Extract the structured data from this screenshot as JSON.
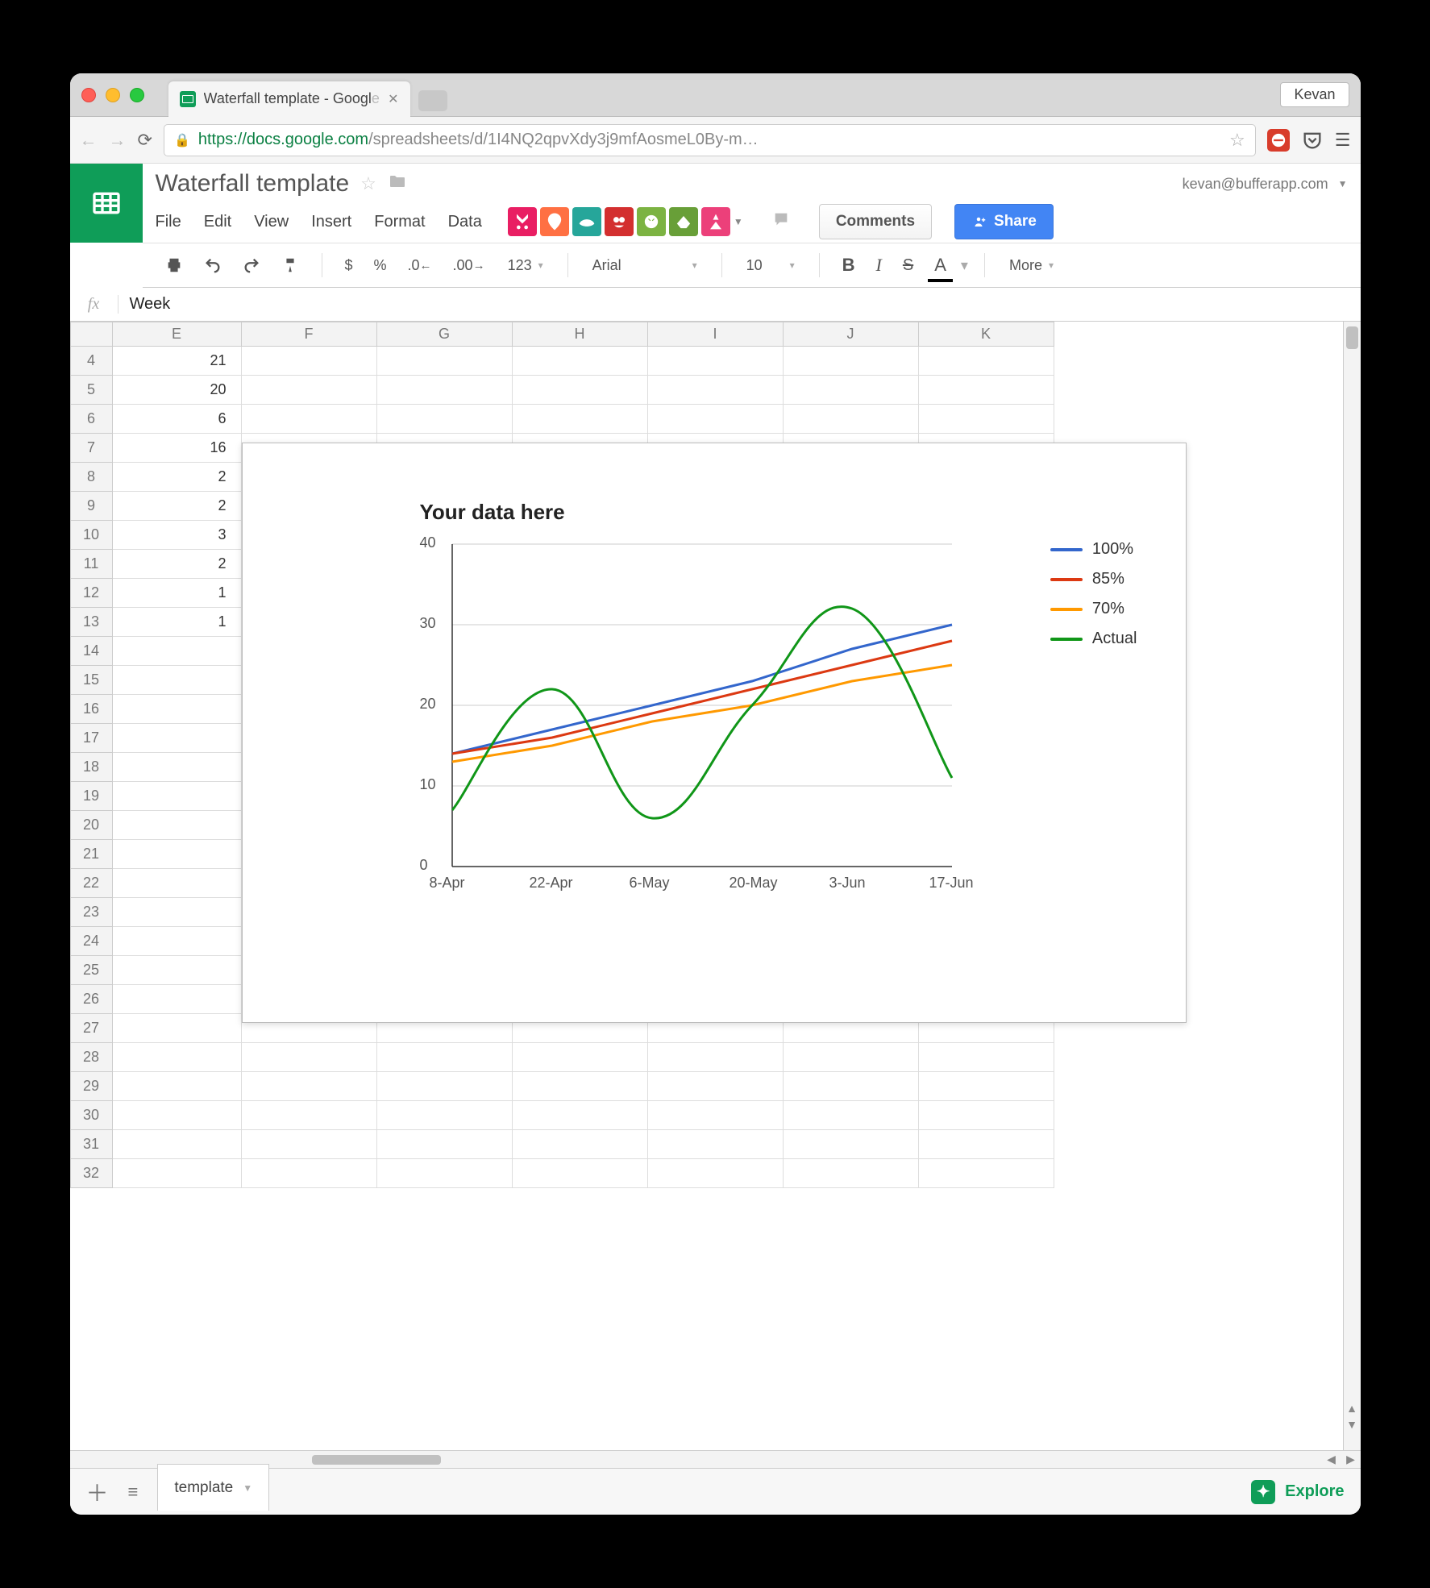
{
  "browser": {
    "profile_name": "Kevan",
    "tab_title": "Waterfall template - Googl",
    "tab_title_fade": "e",
    "url_host": "https://",
    "url_domain": "docs.google.com",
    "url_path": "/spreadsheets/d/1I4NQ2qpvXdy3j9mfAosmeL0By-m…"
  },
  "doc": {
    "title": "Waterfall template",
    "account": "kevan@bufferapp.com",
    "comments_btn": "Comments",
    "share_btn": "Share",
    "menu": {
      "file": "File",
      "edit": "Edit",
      "view": "View",
      "insert": "Insert",
      "format": "Format",
      "data": "Data"
    }
  },
  "toolbar": {
    "currency": "$",
    "percent": "%",
    "dec_dec": ".0",
    "inc_dec": ".00",
    "numfmt": "123",
    "font": "Arial",
    "size": "10",
    "more": "More"
  },
  "fx": {
    "value": "Week"
  },
  "columns": [
    "E",
    "F",
    "G",
    "H",
    "I",
    "J",
    "K"
  ],
  "rows": [
    {
      "n": 4,
      "E": "21"
    },
    {
      "n": 5,
      "E": "20"
    },
    {
      "n": 6,
      "E": "6"
    },
    {
      "n": 7,
      "E": "16"
    },
    {
      "n": 8,
      "E": "2"
    },
    {
      "n": 9,
      "E": "2"
    },
    {
      "n": 10,
      "E": "3"
    },
    {
      "n": 11,
      "E": "2"
    },
    {
      "n": 12,
      "E": "1"
    },
    {
      "n": 13,
      "E": "1"
    },
    {
      "n": 14,
      "E": ""
    },
    {
      "n": 15,
      "E": ""
    },
    {
      "n": 16,
      "E": ""
    },
    {
      "n": 17,
      "E": ""
    },
    {
      "n": 18,
      "E": ""
    },
    {
      "n": 19,
      "E": ""
    },
    {
      "n": 20,
      "E": ""
    },
    {
      "n": 21,
      "E": ""
    },
    {
      "n": 22,
      "E": ""
    },
    {
      "n": 23,
      "E": ""
    },
    {
      "n": 24,
      "E": ""
    },
    {
      "n": 25,
      "E": ""
    },
    {
      "n": 26,
      "E": ""
    },
    {
      "n": 27,
      "E": ""
    },
    {
      "n": 28,
      "E": ""
    },
    {
      "n": 29,
      "E": ""
    },
    {
      "n": 30,
      "E": ""
    },
    {
      "n": 31,
      "E": ""
    },
    {
      "n": 32,
      "E": ""
    }
  ],
  "sheet_tab": "template",
  "explore_label": "Explore",
  "chart_data": {
    "type": "line",
    "title": "Your data here",
    "xlabel": "",
    "ylabel": "",
    "ylim": [
      0,
      40
    ],
    "yticks": [
      0,
      10,
      20,
      30,
      40
    ],
    "categories": [
      "8-Apr",
      "22-Apr",
      "6-May",
      "20-May",
      "3-Jun",
      "17-Jun"
    ],
    "series": [
      {
        "name": "100%",
        "color": "#3366cc",
        "values": [
          14,
          17,
          20,
          23,
          27,
          30
        ]
      },
      {
        "name": "85%",
        "color": "#dc3912",
        "values": [
          14,
          16,
          19,
          22,
          25,
          28
        ]
      },
      {
        "name": "70%",
        "color": "#ff9900",
        "values": [
          13,
          15,
          18,
          20,
          23,
          25
        ]
      },
      {
        "name": "Actual",
        "color": "#109618",
        "values": [
          7,
          22,
          6,
          20,
          32,
          11
        ]
      }
    ]
  }
}
